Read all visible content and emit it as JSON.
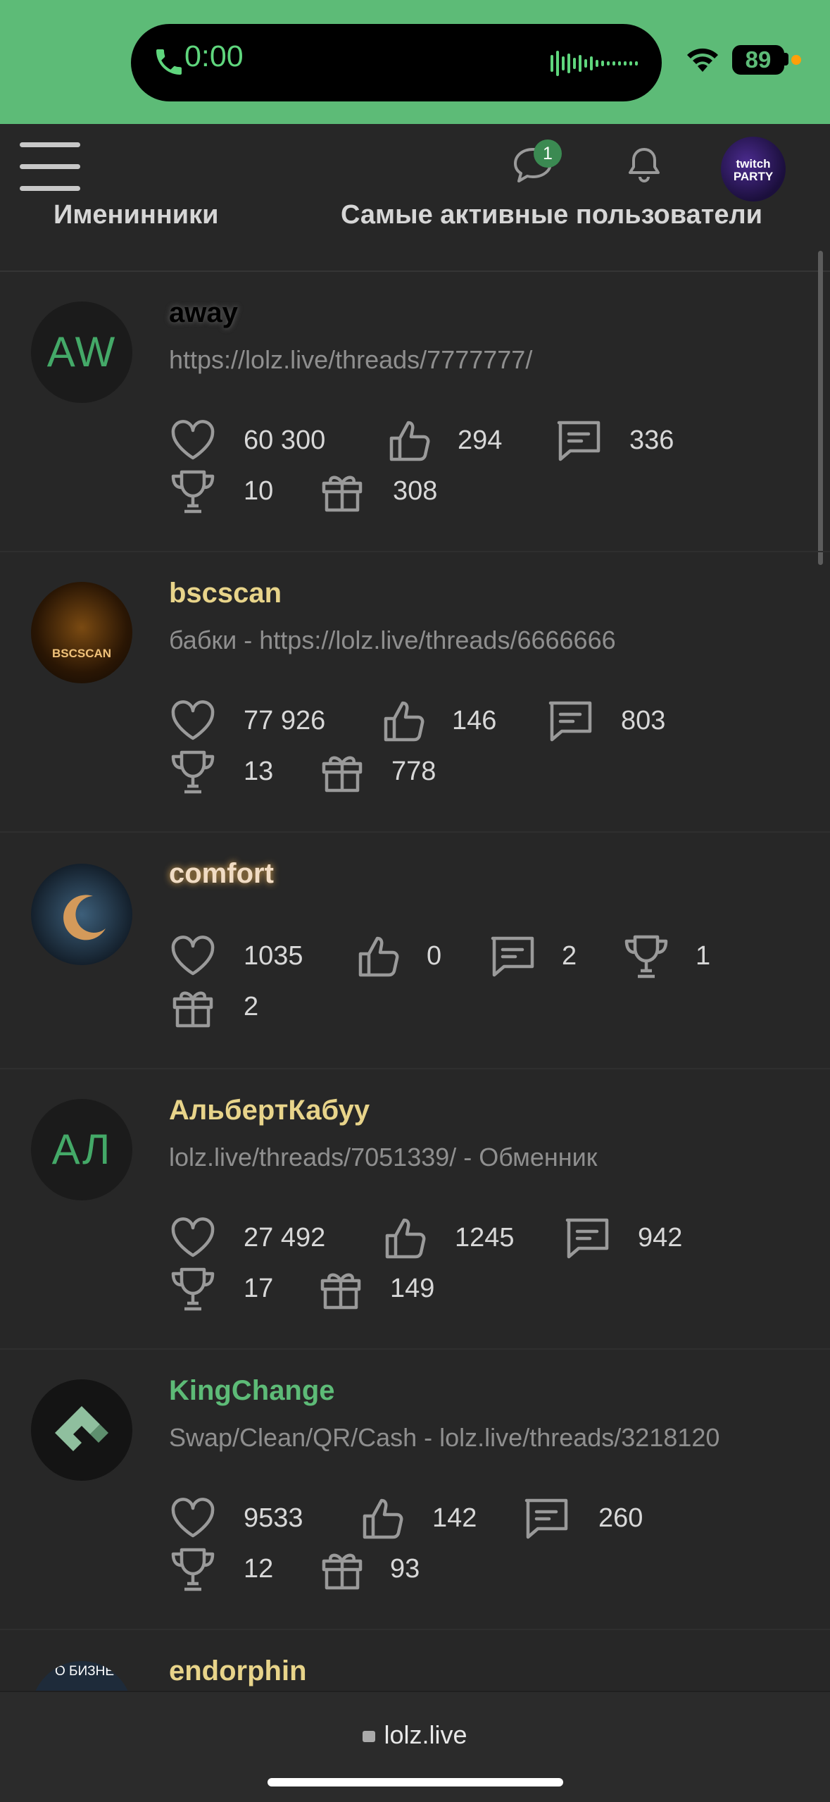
{
  "status_bar": {
    "call_time": "0:00",
    "battery": "89"
  },
  "header": {
    "chat_badge": "1",
    "avatar_text": "twitch PARTY"
  },
  "tabs": [
    "Именинники",
    "Самые активные пользователи"
  ],
  "users": [
    {
      "name": "away",
      "name_color": "#000000",
      "name_glow": "#6a6a6a",
      "avatar_text": "AW",
      "desc": "https://lolz.live/threads/7777777/",
      "likes": "60 300",
      "thumbs": "294",
      "messages": "336",
      "trophies": "10",
      "gifts": "308"
    },
    {
      "name": "bscscan",
      "name_color": "#e8d48a",
      "avatar_text": "BSCSCAN",
      "desc": "бабки - https://lolz.live/threads/6666666",
      "likes": "77 926",
      "thumbs": "146",
      "messages": "803",
      "trophies": "13",
      "gifts": "778"
    },
    {
      "name": "comfort",
      "name_color": "#f1dcc4",
      "name_glow": "#e0a84f",
      "likes": "1035",
      "thumbs": "0",
      "messages": "2",
      "trophies": "1",
      "gifts": "2"
    },
    {
      "name": "АльбертКабуу",
      "name_color": "#e8d48a",
      "avatar_text": "АЛ",
      "desc": "lolz.live/threads/7051339/ - Обменник",
      "likes": "27 492",
      "thumbs": "1245",
      "messages": "942",
      "trophies": "17",
      "gifts": "149"
    },
    {
      "name": "KingChange",
      "name_color": "#5dbb77",
      "desc": "Swap/Clean/QR/Cash - lolz.live/threads/3218120",
      "likes": "9533",
      "thumbs": "142",
      "messages": "260",
      "trophies": "12",
      "gifts": "93"
    },
    {
      "name": "endorphin",
      "name_color": "#e8d48a",
      "avatar_text": "О БИЗНЕ"
    }
  ],
  "bottom": {
    "url": "lolz.live"
  }
}
